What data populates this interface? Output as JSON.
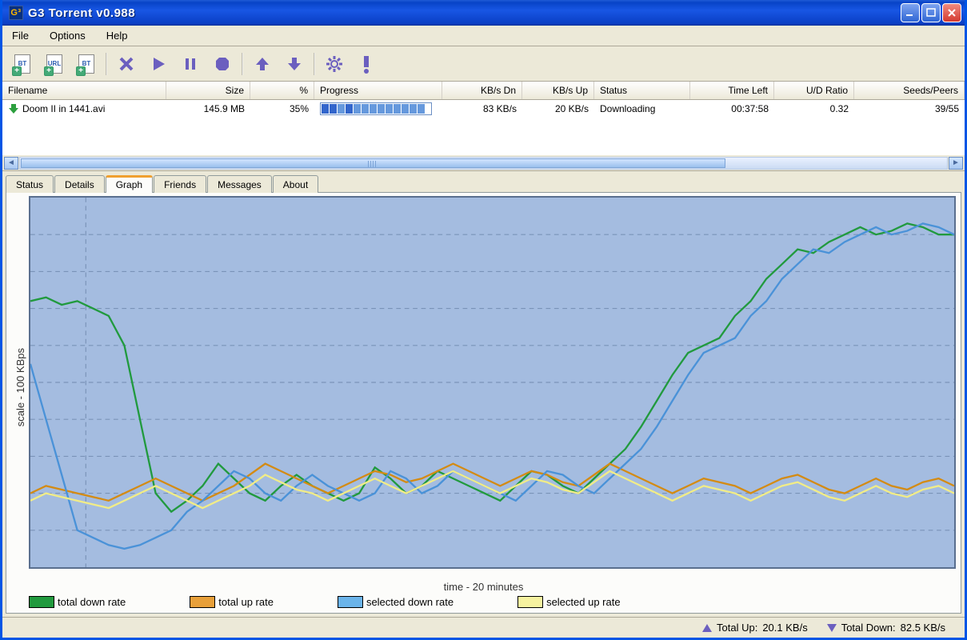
{
  "window": {
    "title": "G3 Torrent v0.988"
  },
  "menu": {
    "file": "File",
    "options": "Options",
    "help": "Help"
  },
  "columns": {
    "filename": "Filename",
    "size": "Size",
    "percent": "%",
    "progress": "Progress",
    "kbdn": "KB/s Dn",
    "kbup": "KB/s Up",
    "status": "Status",
    "timeleft": "Time Left",
    "udratio": "U/D Ratio",
    "seedspeers": "Seeds/Peers"
  },
  "torrents": [
    {
      "filename": "Doom II in 1441.avi",
      "size": "145.9 MB",
      "percent": "35%",
      "kbdn": "83 KB/s",
      "kbup": "20 KB/s",
      "status": "Downloading",
      "timeleft": "00:37:58",
      "udratio": "0.32",
      "seedspeers": "39/55"
    }
  ],
  "tabs": {
    "status": "Status",
    "details": "Details",
    "graph": "Graph",
    "friends": "Friends",
    "messages": "Messages",
    "about": "About"
  },
  "graph": {
    "ylabel": "scale - 100 KBps",
    "xlabel": "time - 20 minutes",
    "legend": {
      "total_down": "total down rate",
      "total_up": "total up rate",
      "selected_down": "selected down rate",
      "selected_up": "selected up rate"
    }
  },
  "statusbar": {
    "total_up_label": "Total Up:",
    "total_up_value": "20.1 KB/s",
    "total_down_label": "Total Down:",
    "total_down_value": "82.5 KB/s"
  },
  "chart_data": {
    "type": "line",
    "xlabel": "time - 20 minutes",
    "ylabel": "scale - 100 KBps",
    "xrange": [
      0,
      20
    ],
    "yrange": [
      0,
      100
    ],
    "series": [
      {
        "name": "total down rate",
        "color": "#219a3e",
        "values": [
          72,
          73,
          71,
          72,
          70,
          68,
          60,
          40,
          20,
          15,
          18,
          22,
          28,
          24,
          20,
          18,
          22,
          25,
          22,
          20,
          18,
          20,
          27,
          24,
          20,
          22,
          26,
          24,
          22,
          20,
          18,
          22,
          26,
          25,
          22,
          20,
          24,
          28,
          32,
          38,
          45,
          52,
          58,
          60,
          62,
          68,
          72,
          78,
          82,
          86,
          85,
          88,
          90,
          92,
          90,
          91,
          93,
          92,
          90,
          90
        ]
      },
      {
        "name": "total up rate",
        "color": "#d48b13",
        "values": [
          20,
          22,
          21,
          20,
          19,
          18,
          20,
          22,
          24,
          22,
          20,
          18,
          20,
          22,
          25,
          28,
          26,
          24,
          22,
          20,
          22,
          24,
          26,
          25,
          23,
          24,
          26,
          28,
          26,
          24,
          22,
          24,
          26,
          25,
          23,
          22,
          25,
          28,
          26,
          24,
          22,
          20,
          22,
          24,
          23,
          22,
          20,
          22,
          24,
          25,
          23,
          21,
          20,
          22,
          24,
          22,
          21,
          23,
          24,
          22
        ]
      },
      {
        "name": "selected down rate",
        "color": "#4a92d8",
        "values": [
          55,
          40,
          25,
          10,
          8,
          6,
          5,
          6,
          8,
          10,
          15,
          18,
          22,
          26,
          24,
          20,
          18,
          22,
          25,
          22,
          20,
          18,
          20,
          26,
          24,
          20,
          22,
          26,
          24,
          22,
          20,
          18,
          22,
          26,
          25,
          22,
          20,
          24,
          28,
          32,
          38,
          45,
          52,
          58,
          60,
          62,
          68,
          72,
          78,
          82,
          86,
          85,
          88,
          90,
          92,
          90,
          91,
          93,
          92,
          90
        ]
      },
      {
        "name": "selected up rate",
        "color": "#f1ec87",
        "values": [
          18,
          20,
          19,
          18,
          17,
          16,
          18,
          20,
          22,
          20,
          18,
          16,
          18,
          20,
          22,
          25,
          23,
          21,
          20,
          18,
          20,
          22,
          24,
          22,
          20,
          22,
          24,
          26,
          24,
          22,
          20,
          22,
          24,
          23,
          21,
          20,
          23,
          26,
          24,
          22,
          20,
          18,
          20,
          22,
          21,
          20,
          18,
          20,
          22,
          23,
          21,
          19,
          18,
          20,
          22,
          20,
          19,
          21,
          22,
          20
        ]
      }
    ]
  }
}
